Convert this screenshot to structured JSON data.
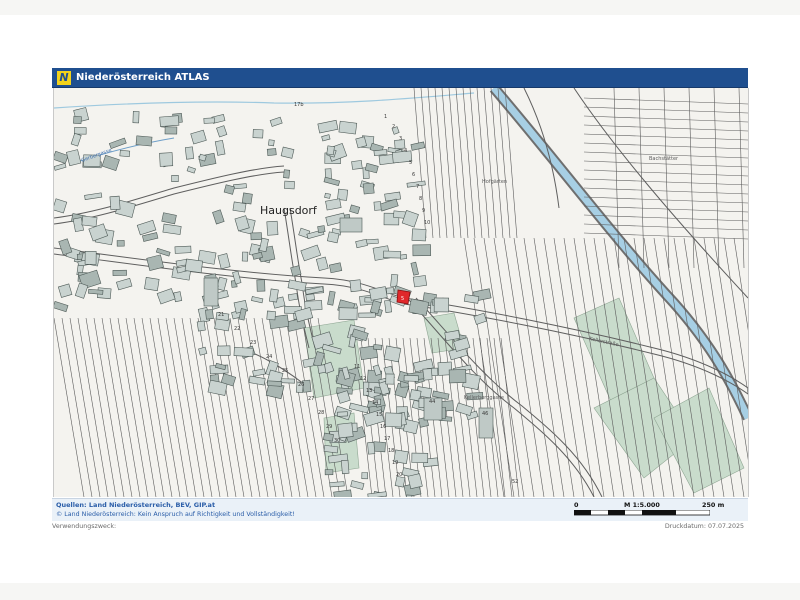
{
  "header": {
    "logo_letter": "N",
    "title": "Niederösterreich ATLAS"
  },
  "map": {
    "town_label": "Haugsdorf",
    "street_labels": [
      "Gerbergasse",
      "Hofgärten",
      "Bachstätter",
      "Kellerstraße",
      "Kellerberggasse"
    ],
    "lot_numbers": [
      "1",
      "2",
      "3",
      "4",
      "5",
      "6",
      "7",
      "8",
      "9",
      "10",
      "11",
      "12",
      "13",
      "14",
      "15",
      "16",
      "17",
      "18",
      "19",
      "20",
      "21",
      "22",
      "23",
      "24",
      "25",
      "26",
      "27",
      "28",
      "29",
      "30",
      "44",
      "46",
      "52",
      "17b"
    ],
    "marker_number": "5",
    "colors": {
      "background": "#f4f3ef",
      "building": "#c9d3d0",
      "building_dark": "#a9b6b2",
      "field_line": "#5a5a5a",
      "road": "#6b6b6b",
      "river_blue": "#9ec9df",
      "green_block": "#c6d9c9",
      "marker": "#e0282b"
    }
  },
  "footer": {
    "sources": "Quellen: Land Niederösterreich, BEV, GIP.at",
    "copyright": "© Land Niederösterreich: Kein Anspruch auf Richtigkeit und Vollständigkeit!",
    "scale_zero": "0",
    "scale_label": "M 1:5.000",
    "scale_max": "250 m"
  },
  "page": {
    "purpose": "Verwendungszweck:",
    "print_date": "Druckdatum: 07.07.2025"
  }
}
